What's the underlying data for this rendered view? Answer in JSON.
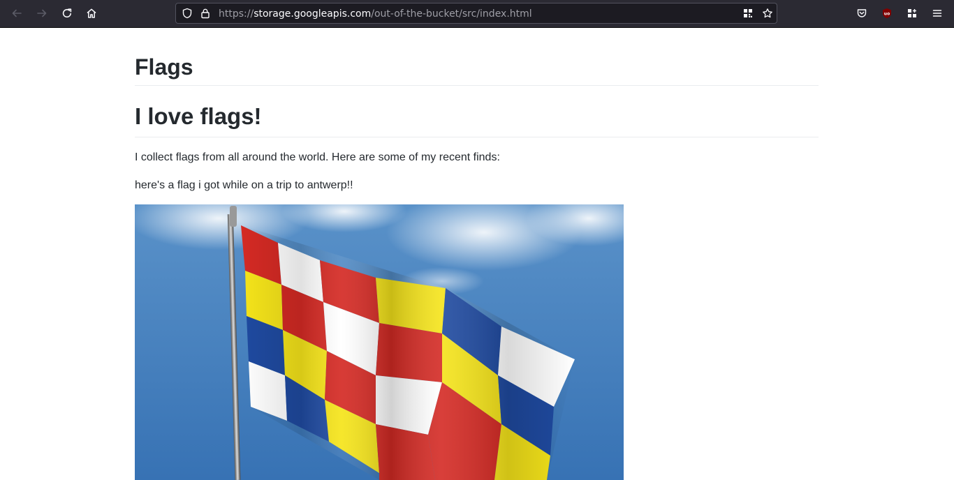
{
  "browser": {
    "url": {
      "scheme": "https://",
      "host": "storage.googleapis.com",
      "path": "/out-of-the-bucket/src/index.html"
    },
    "icons": {
      "back": "back-arrow-icon",
      "forward": "forward-arrow-icon",
      "reload": "reload-icon",
      "home": "home-icon",
      "tracking": "shield-icon",
      "secure": "lock-icon",
      "qr": "qr-code-icon",
      "bookmark": "star-icon",
      "pocket": "pocket-icon",
      "ublock": "ublock-icon",
      "extensions": "extensions-icon",
      "menu": "hamburger-menu-icon"
    },
    "colors": {
      "toolbar": "#2b2a33",
      "urlbar": "#1c1b22",
      "ublock": "#800000"
    }
  },
  "page": {
    "title": "Flags",
    "heading": "I love flags!",
    "intro": "I collect flags from all around the world. Here are some of my recent finds:",
    "caption": "here's a flag i got while on a trip to antwerp!!",
    "image": {
      "subject": "antwerp-flag-photo",
      "colors": [
        "#d42a24",
        "#ffffff",
        "#f5e41a",
        "#1f4aa0",
        "#3d7dbf"
      ]
    }
  }
}
